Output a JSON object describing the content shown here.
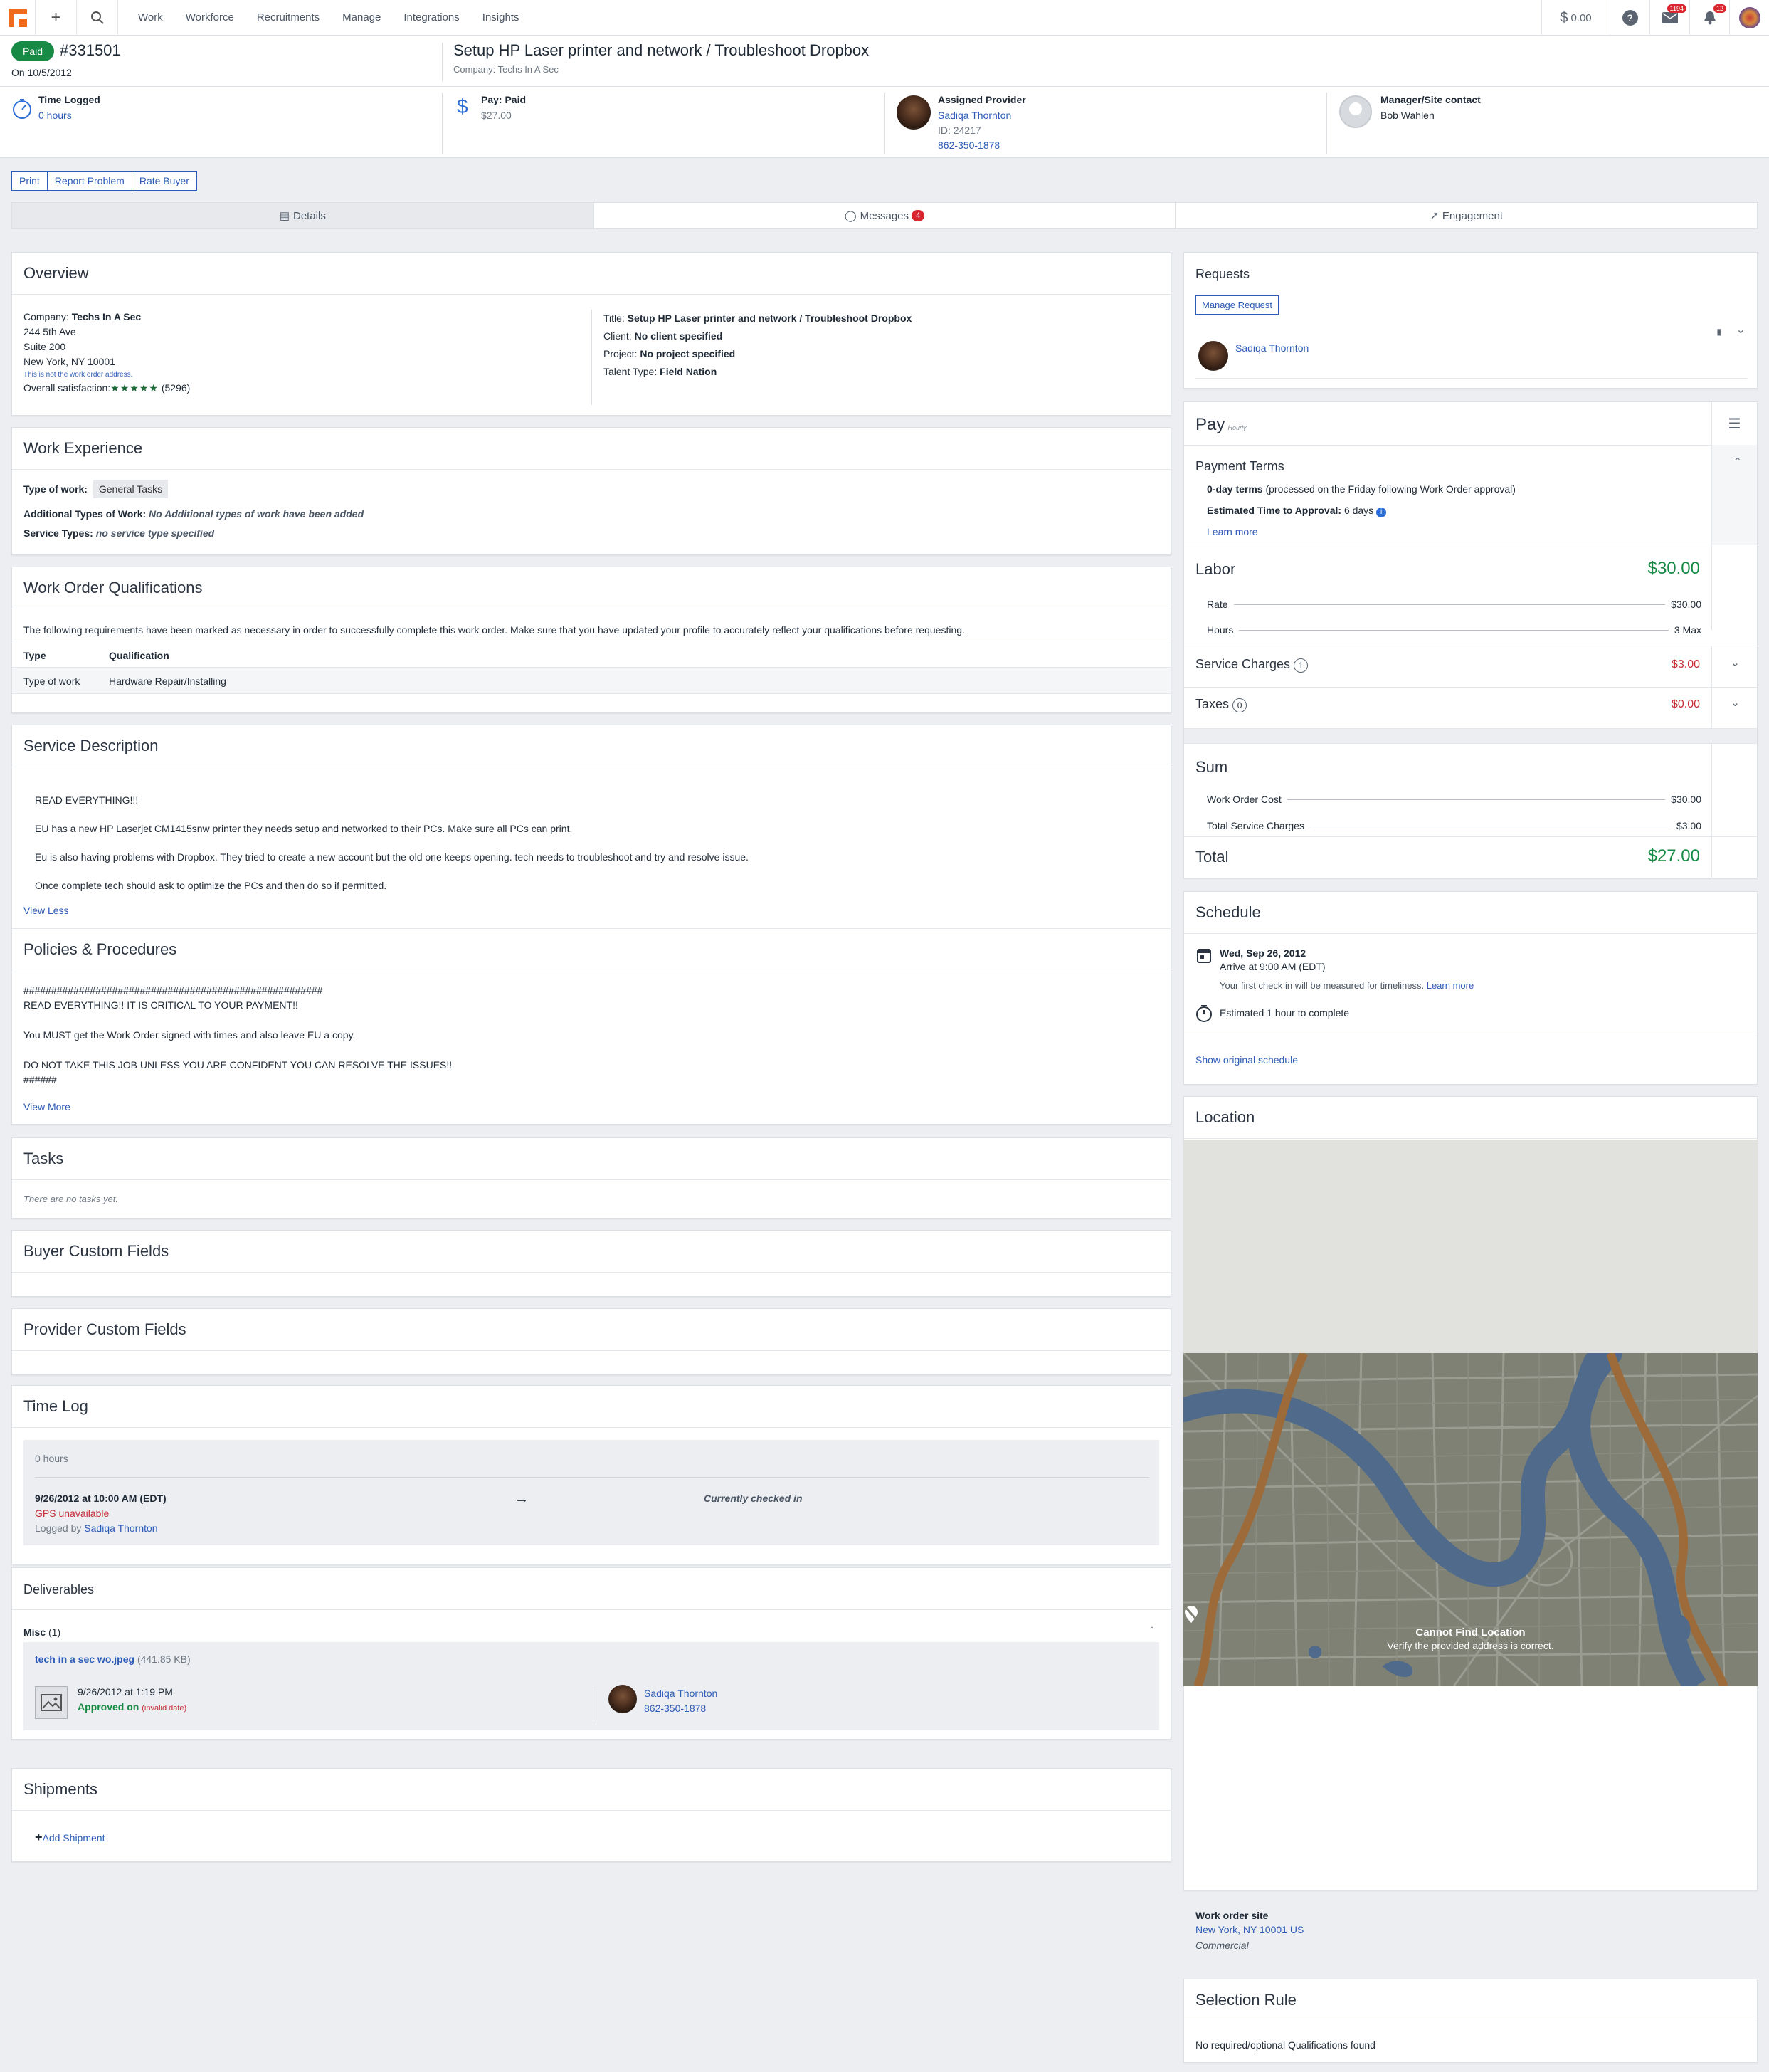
{
  "nav": {
    "links": [
      "Work",
      "Workforce",
      "Recruitments",
      "Manage",
      "Integrations",
      "Insights"
    ],
    "balance": "0.00",
    "mail_count": "1194",
    "notif_count": "12"
  },
  "header": {
    "status": "Paid",
    "wo_number": "#331501",
    "date": "On 10/5/2012",
    "title": "Setup HP Laser printer and network / Troubleshoot Dropbox",
    "company": "Company: Techs In A Sec"
  },
  "summary": {
    "time_label": "Time Logged",
    "time_value": "0 hours",
    "pay_label": "Pay: Paid",
    "pay_value": "$27.00",
    "provider_label": "Assigned Provider",
    "provider_name": "Sadiqa Thornton",
    "provider_id": "ID: 24217",
    "provider_phone": "862-350-1878",
    "manager_label": "Manager/Site contact",
    "manager_name": "Bob Wahlen"
  },
  "actions": [
    "Print",
    "Report Problem",
    "Rate Buyer"
  ],
  "tabs": {
    "details": "Details",
    "messages": "Messages",
    "messages_count": "4",
    "engagement": "Engagement"
  },
  "overview": {
    "title": "Overview",
    "company_label": "Company:",
    "company": "Techs In A Sec",
    "addr1": "244 5th Ave",
    "addr2": "Suite 200",
    "addr3": "New York, NY 10001",
    "note": "This is not the work order address.",
    "satisfaction_label": "Overall satisfaction:",
    "stars": "★★★★★",
    "reviews": "(5296)",
    "title_label": "Title:",
    "title_value": "Setup HP Laser printer and network / Troubleshoot Dropbox",
    "client_label": "Client:",
    "client_value": "No client specified",
    "project_label": "Project:",
    "project_value": "No project specified",
    "talent_label": "Talent Type:",
    "talent_value": "Field Nation"
  },
  "work_experience": {
    "title": "Work Experience",
    "type_label": "Type of work:",
    "type_value": "General Tasks",
    "additional_label": "Additional Types of Work:",
    "additional_value": "No Additional types of work have been added",
    "service_label": "Service Types:",
    "service_value": "no service type specified"
  },
  "qualifications": {
    "title": "Work Order Qualifications",
    "intro": "The following requirements have been marked as necessary in order to successfully complete this work order. Make sure that you have updated your profile to accurately reflect your qualifications before requesting.",
    "col_type": "Type",
    "col_qual": "Qualification",
    "row_type": "Type of work",
    "row_qual": "Hardware Repair/Installing"
  },
  "service_description": {
    "title": "Service Description",
    "p1": "READ EVERYTHING!!!",
    "p2": "EU has a new HP Laserjet CM1415snw printer they needs setup and networked to their PCs. Make sure all PCs can print.",
    "p3": "Eu is also having problems with Dropbox. They tried to create a new account but the old one keeps opening. tech needs to troubleshoot and try and resolve issue.",
    "p4": "Once complete tech should ask to optimize the PCs and then do so if permitted.",
    "toggle": "View Less"
  },
  "policies": {
    "title": "Policies & Procedures",
    "l1": "######################################################",
    "l2": "READ EVERYTHING!! IT IS CRITICAL TO YOUR PAYMENT!!",
    "l3": "You MUST get the Work Order signed with times and also leave EU a copy.",
    "l4": "DO NOT TAKE THIS JOB UNLESS YOU ARE CONFIDENT YOU CAN RESOLVE THE ISSUES!!",
    "l5": "######",
    "toggle": "View More"
  },
  "tasks": {
    "title": "Tasks",
    "empty": "There are no tasks yet."
  },
  "buyer_fields": {
    "title": "Buyer Custom Fields"
  },
  "provider_fields": {
    "title": "Provider Custom Fields"
  },
  "time_log": {
    "title": "Time Log",
    "hours": "0 hours",
    "checkin": "9/26/2012 at 10:00 AM (EDT)",
    "gps": "GPS unavailable",
    "logged_by": "Logged by",
    "logged_name": "Sadiqa Thornton",
    "status": "Currently checked in"
  },
  "deliverables": {
    "title": "Deliverables",
    "group": "Misc",
    "group_count": "(1)",
    "file": "tech in a sec wo.jpeg",
    "size": "(441.85 KB)",
    "uploaded": "9/26/2012 at 1:19 PM",
    "approved_label": "Approved on",
    "approved_value": "(invalid date)",
    "uploader": "Sadiqa Thornton",
    "uploader_phone": "862-350-1878"
  },
  "shipments": {
    "title": "Shipments",
    "add": "Add Shipment"
  },
  "requests": {
    "title": "Requests",
    "manage": "Manage Request",
    "name": "Sadiqa Thornton"
  },
  "pay": {
    "title": "Pay",
    "subtitle": "Hourly",
    "terms_title": "Payment Terms",
    "terms_bold": "0-day terms",
    "terms_rest": "(processed on the Friday following Work Order approval)",
    "eta_label": "Estimated Time to Approval:",
    "eta_value": "6 days",
    "learn_more": "Learn more",
    "labor_label": "Labor",
    "labor_value": "$30.00",
    "rate_label": "Rate",
    "rate_value": "$30.00",
    "hours_label": "Hours",
    "hours_value": "3 Max",
    "service_label": "Service Charges",
    "service_count": "1",
    "service_value": "$3.00",
    "taxes_label": "Taxes",
    "taxes_count": "0",
    "taxes_value": "$0.00",
    "sum_label": "Sum",
    "wo_cost_label": "Work Order Cost",
    "wo_cost_value": "$30.00",
    "svc_total_label": "Total Service Charges",
    "svc_total_value": "$3.00",
    "total_label": "Total",
    "total_value": "$27.00"
  },
  "schedule": {
    "title": "Schedule",
    "date": "Wed, Sep 26, 2012",
    "arrive": "Arrive at 9:00 AM (EDT)",
    "note": "Your first check in will be measured for timeliness.",
    "learn_more": "Learn more",
    "estimate": "Estimated 1 hour to complete",
    "original": "Show original schedule"
  },
  "location": {
    "title": "Location",
    "map_error": "Cannot Find Location",
    "map_hint": "Verify the provided address is correct.",
    "site_label": "Work order site",
    "site_addr": "New York, NY 10001 US",
    "site_type": "Commercial"
  },
  "selection_rule": {
    "title": "Selection Rule",
    "text": "No required/optional Qualifications found"
  }
}
